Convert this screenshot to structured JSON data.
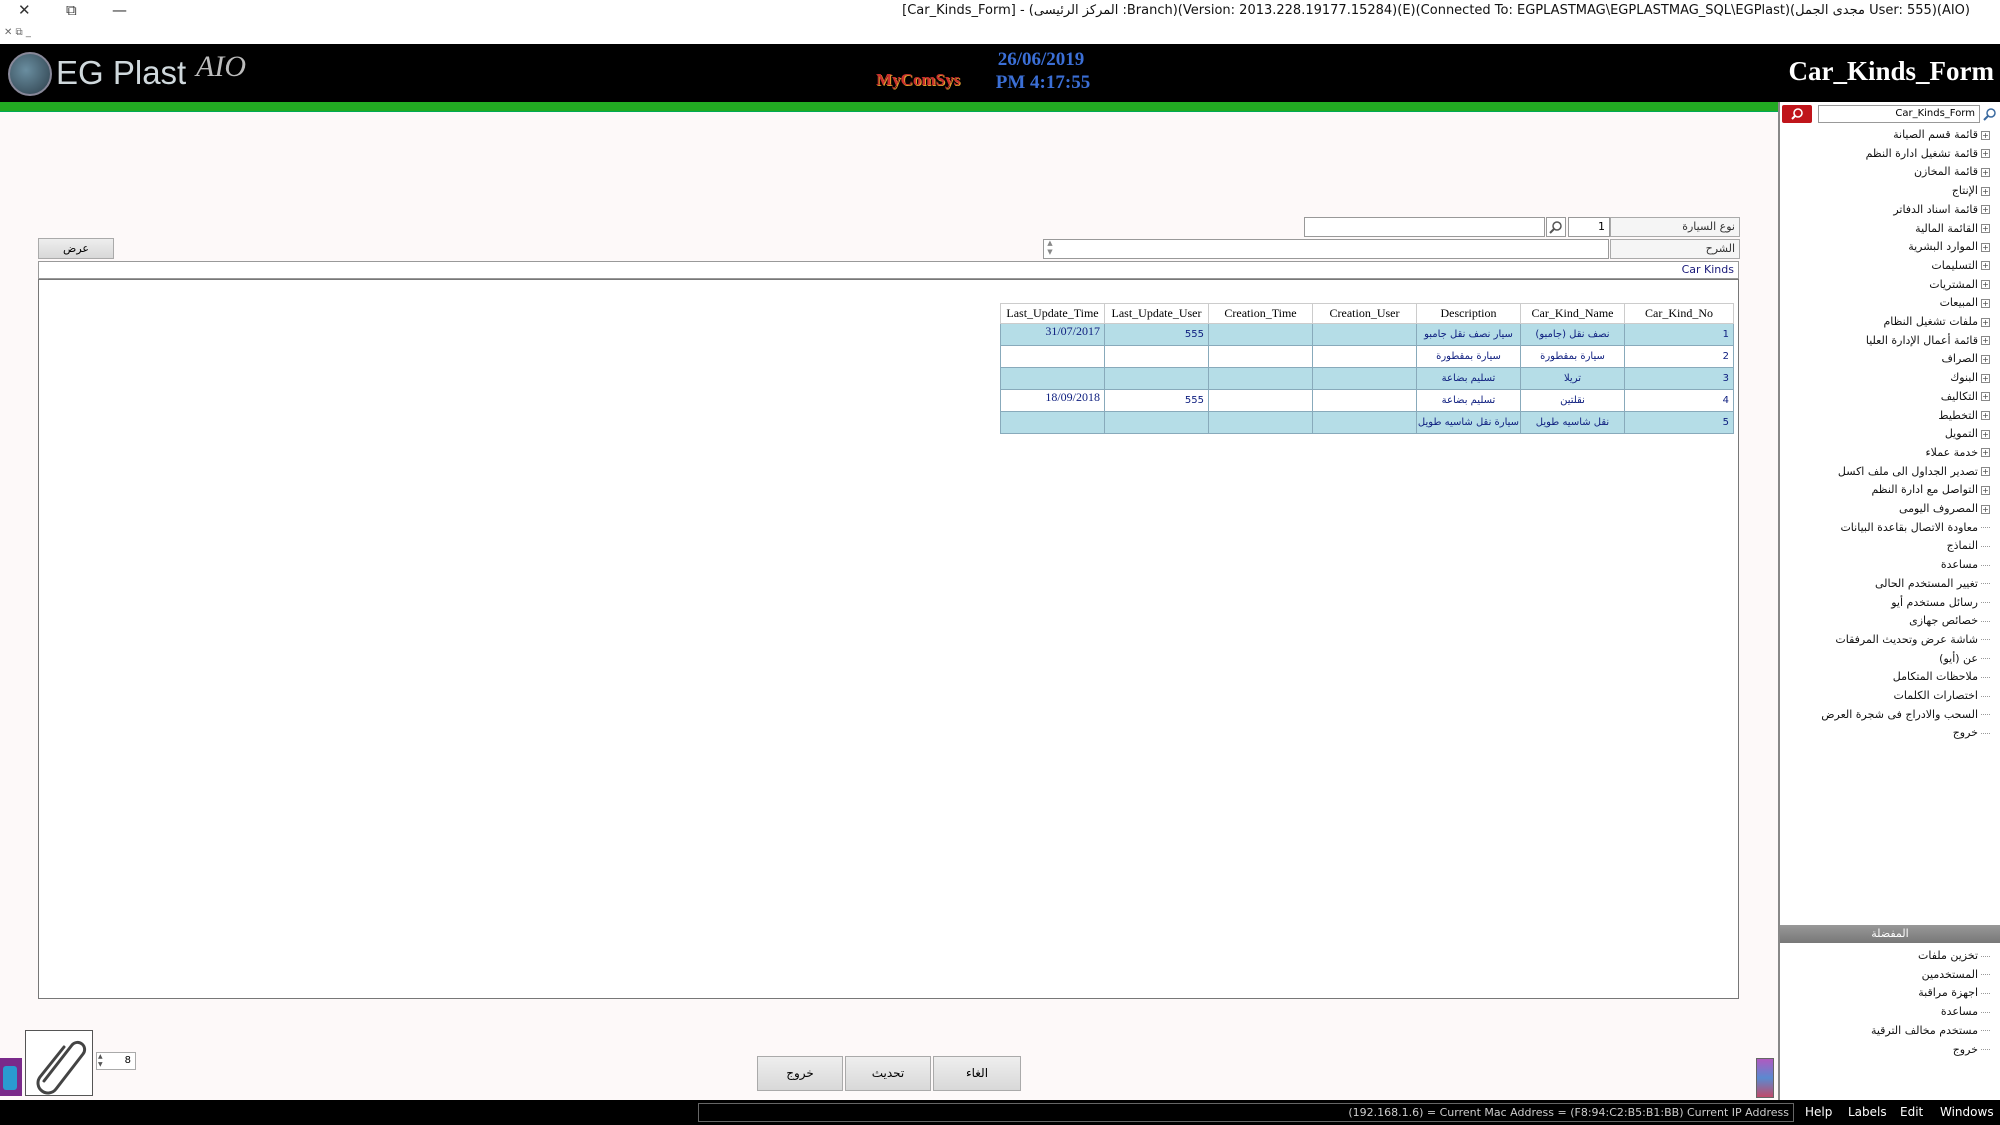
{
  "window": {
    "title": "[Car_Kinds_Form] - (المركز الرئيسى :Branch)(Version: 2013.228.19177.15284)(E)(Connected To: EGPLASTMAG\\EGPLASTMAG_SQL\\EGPlast)(مجدى الجمل User: 555)(AIO)",
    "close_glyph": "✕",
    "restore_glyph": "⧉",
    "minimize_glyph": "—",
    "mdi_controls": "✕ ⧉ _"
  },
  "header": {
    "brand": "EG Plast",
    "brand_suffix": "AIO",
    "vendor": "MyComSys",
    "date": "26/06/2019",
    "time": "PM 4:17:55",
    "form_title": "Car_Kinds_Form"
  },
  "form": {
    "car_type_label": "نوع السيارة",
    "car_type_code": "1",
    "car_type_name": "",
    "description_label": "الشرح",
    "description_value": "",
    "show_button": "عرض",
    "grid_title": "Car Kinds"
  },
  "grid": {
    "columns": [
      "Car_Kind_No",
      "Car_Kind_Name",
      "Description",
      "Creation_User",
      "Creation_Time",
      "Last_Update_User",
      "Last_Update_Time"
    ],
    "rows": [
      {
        "no": "1",
        "name": "نصف نقل (جامبو)",
        "description": "سيار نصف نقل جامبو",
        "creation_user": "",
        "creation_time": "",
        "update_user": "555",
        "update_time": "31/07/2017"
      },
      {
        "no": "2",
        "name": "سيارة بمقطورة",
        "description": "سيارة بمقطورة",
        "creation_user": "",
        "creation_time": "",
        "update_user": "",
        "update_time": ""
      },
      {
        "no": "3",
        "name": "تريلا",
        "description": "تسليم بضاعة",
        "creation_user": "",
        "creation_time": "",
        "update_user": "",
        "update_time": ""
      },
      {
        "no": "4",
        "name": "نقلتين",
        "description": "تسليم بضاعة",
        "creation_user": "",
        "creation_time": "",
        "update_user": "555",
        "update_time": "18/09/2018"
      },
      {
        "no": "5",
        "name": "نقل شاسيه طويل",
        "description": "سيارة نقل شاسيه طويل",
        "creation_user": "",
        "creation_time": "",
        "update_user": "",
        "update_time": ""
      }
    ]
  },
  "footer": {
    "exit_button": "خروج",
    "refresh_button": "تحديث",
    "cancel_button": "الغاء",
    "attachment_count": "8"
  },
  "sidebar": {
    "search_value": "Car_Kinds_Form",
    "tree_items": [
      {
        "label": "قائمة قسم الصيانة",
        "expandable": true
      },
      {
        "label": "قائمة تشغيل ادارة النظم",
        "expandable": true
      },
      {
        "label": "قائمة المخازن",
        "expandable": true
      },
      {
        "label": "الإنتاج",
        "expandable": true
      },
      {
        "label": "قائمة اسناد الدفاتر",
        "expandable": true
      },
      {
        "label": "القائمة المالية",
        "expandable": true
      },
      {
        "label": "الموارد البشرية",
        "expandable": true
      },
      {
        "label": "التسليمات",
        "expandable": true
      },
      {
        "label": "المشتريات",
        "expandable": true
      },
      {
        "label": "المبيعات",
        "expandable": true
      },
      {
        "label": "ملفات تشغيل النظام",
        "expandable": true
      },
      {
        "label": "قائمة أعمال الإدارة العليا",
        "expandable": true
      },
      {
        "label": "الصراف",
        "expandable": true
      },
      {
        "label": "البنوك",
        "expandable": true
      },
      {
        "label": "التكاليف",
        "expandable": true
      },
      {
        "label": "التخطيط",
        "expandable": true
      },
      {
        "label": "التمويل",
        "expandable": true
      },
      {
        "label": "خدمة عملاء",
        "expandable": true
      },
      {
        "label": "تصدير الجداول الى ملف اكسل",
        "expandable": true
      },
      {
        "label": "التواصل مع ادارة النظم",
        "expandable": true
      },
      {
        "label": "المصروف اليومى",
        "expandable": true
      },
      {
        "label": "معاودة الاتصال بقاعدة البيانات",
        "expandable": false
      },
      {
        "label": "النماذج",
        "expandable": false
      },
      {
        "label": "مساعدة",
        "expandable": false
      },
      {
        "label": "تغيير المستخدم الحالى",
        "expandable": false
      },
      {
        "label": "رسائل مستخدم أيو",
        "expandable": false
      },
      {
        "label": "خصائص جهازى",
        "expandable": false
      },
      {
        "label": "شاشة عرض وتحديث المرفقات",
        "expandable": false
      },
      {
        "label": "عن (أيو)",
        "expandable": false
      },
      {
        "label": "ملاحظات المتكامل",
        "expandable": false
      },
      {
        "label": "اختصارات الكلمات",
        "expandable": false
      },
      {
        "label": "السحب والادراج فى شجرة العرض",
        "expandable": false
      },
      {
        "label": "خروج",
        "expandable": false
      }
    ],
    "favorites_title": "المفضلة",
    "favorites": [
      "تخزين ملفات",
      "المستخدمين",
      "اجهزة مراقبة",
      "مساعدة",
      "مستخدم مخالف الترقية",
      "خروج"
    ]
  },
  "statusbar": {
    "ip_info": "(192.168.1.6) = Current Mac Address = (F8:94:C2:B5:B1:BB) Current IP Address",
    "menu": [
      "Help",
      "Labels",
      "Edit",
      "Windows"
    ]
  },
  "icons": {
    "search": "search-icon",
    "attachment": "paperclip-icon",
    "expand": "plus-icon"
  },
  "colors": {
    "accent_green": "#22aa22",
    "row_highlight": "#b5dde7",
    "header_bg": "#000000",
    "clock": "#3b6fd6"
  }
}
